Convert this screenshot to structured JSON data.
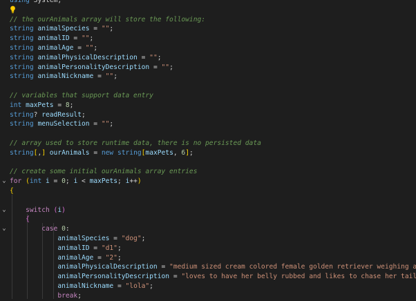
{
  "editor": {
    "language": "C#",
    "colors": {
      "background": "#1e1e1e",
      "keyword": "#569cd6",
      "control": "#c586c0",
      "identifier": "#9cdcfe",
      "string": "#ce9178",
      "number": "#b5cea8",
      "comment": "#6a9955"
    },
    "lines": [
      [
        [
          "using",
          "kw"
        ],
        [
          " System;",
          "pl"
        ]
      ],
      [],
      [
        [
          "// the ourAnimals array will store the following:",
          "cmt"
        ]
      ],
      [
        [
          "string",
          "kw"
        ],
        [
          " ",
          "pl"
        ],
        [
          "animalSpecies",
          "id"
        ],
        [
          " = ",
          "pl"
        ],
        [
          "\"\"",
          "str"
        ],
        [
          ";",
          "pl"
        ]
      ],
      [
        [
          "string",
          "kw"
        ],
        [
          " ",
          "pl"
        ],
        [
          "animalID",
          "id"
        ],
        [
          " = ",
          "pl"
        ],
        [
          "\"\"",
          "str"
        ],
        [
          ";",
          "pl"
        ]
      ],
      [
        [
          "string",
          "kw"
        ],
        [
          " ",
          "pl"
        ],
        [
          "animalAge",
          "id"
        ],
        [
          " = ",
          "pl"
        ],
        [
          "\"\"",
          "str"
        ],
        [
          ";",
          "pl"
        ]
      ],
      [
        [
          "string",
          "kw"
        ],
        [
          " ",
          "pl"
        ],
        [
          "animalPhysicalDescription",
          "id"
        ],
        [
          " = ",
          "pl"
        ],
        [
          "\"\"",
          "str"
        ],
        [
          ";",
          "pl"
        ]
      ],
      [
        [
          "string",
          "kw"
        ],
        [
          " ",
          "pl"
        ],
        [
          "animalPersonalityDescription",
          "id"
        ],
        [
          " = ",
          "pl"
        ],
        [
          "\"\"",
          "str"
        ],
        [
          ";",
          "pl"
        ]
      ],
      [
        [
          "string",
          "kw"
        ],
        [
          " ",
          "pl"
        ],
        [
          "animalNickname",
          "id"
        ],
        [
          " = ",
          "pl"
        ],
        [
          "\"\"",
          "str"
        ],
        [
          ";",
          "pl"
        ]
      ],
      [],
      [
        [
          "// variables that support data entry",
          "cmt"
        ]
      ],
      [
        [
          "int",
          "kw"
        ],
        [
          " ",
          "pl"
        ],
        [
          "maxPets",
          "id"
        ],
        [
          " = ",
          "pl"
        ],
        [
          "8",
          "num"
        ],
        [
          ";",
          "pl"
        ]
      ],
      [
        [
          "string",
          "kw"
        ],
        [
          "? ",
          "pl"
        ],
        [
          "readResult",
          "id"
        ],
        [
          ";",
          "pl"
        ]
      ],
      [
        [
          "string",
          "kw"
        ],
        [
          " ",
          "pl"
        ],
        [
          "menuSelection",
          "id"
        ],
        [
          " = ",
          "pl"
        ],
        [
          "\"\"",
          "str"
        ],
        [
          ";",
          "pl"
        ]
      ],
      [],
      [
        [
          "// array used to store runtime data, there is no persisted data",
          "cmt"
        ]
      ],
      [
        [
          "string",
          "kw"
        ],
        [
          "[",
          "br1"
        ],
        [
          ",",
          "pl"
        ],
        [
          "]",
          "br1"
        ],
        [
          " ",
          "pl"
        ],
        [
          "ourAnimals",
          "id"
        ],
        [
          " = ",
          "pl"
        ],
        [
          "new",
          "kw"
        ],
        [
          " ",
          "pl"
        ],
        [
          "string",
          "kw"
        ],
        [
          "[",
          "br1"
        ],
        [
          "maxPets",
          "id"
        ],
        [
          ", ",
          "pl"
        ],
        [
          "6",
          "num"
        ],
        [
          "]",
          "br1"
        ],
        [
          ";",
          "pl"
        ]
      ],
      [],
      [
        [
          "// create some initial ourAnimals array entries",
          "cmt"
        ]
      ],
      [
        [
          "for",
          "ctl"
        ],
        [
          " ",
          "pl"
        ],
        [
          "(",
          "br1"
        ],
        [
          "int",
          "kw"
        ],
        [
          " ",
          "pl"
        ],
        [
          "i",
          "id"
        ],
        [
          " = ",
          "pl"
        ],
        [
          "0",
          "num"
        ],
        [
          "; ",
          "pl"
        ],
        [
          "i",
          "id"
        ],
        [
          " < ",
          "pl"
        ],
        [
          "maxPets",
          "id"
        ],
        [
          "; ",
          "pl"
        ],
        [
          "i",
          "id"
        ],
        [
          "++",
          "pl"
        ],
        [
          ")",
          "br1"
        ]
      ],
      [
        [
          "{",
          "br1"
        ]
      ],
      [],
      [
        [
          "    ",
          "pl"
        ],
        [
          "switch",
          "ctl"
        ],
        [
          " ",
          "pl"
        ],
        [
          "(",
          "br2"
        ],
        [
          "i",
          "id"
        ],
        [
          ")",
          "br2"
        ]
      ],
      [
        [
          "    ",
          "pl"
        ],
        [
          "{",
          "br2"
        ]
      ],
      [
        [
          "        ",
          "pl"
        ],
        [
          "case",
          "ctl"
        ],
        [
          " ",
          "pl"
        ],
        [
          "0",
          "num"
        ],
        [
          ":",
          "pl"
        ]
      ],
      [
        [
          "            ",
          "pl"
        ],
        [
          "animalSpecies",
          "id"
        ],
        [
          " = ",
          "pl"
        ],
        [
          "\"dog\"",
          "str"
        ],
        [
          ";",
          "pl"
        ]
      ],
      [
        [
          "            ",
          "pl"
        ],
        [
          "animalID",
          "id"
        ],
        [
          " = ",
          "pl"
        ],
        [
          "\"d1\"",
          "str"
        ],
        [
          ";",
          "pl"
        ]
      ],
      [
        [
          "            ",
          "pl"
        ],
        [
          "animalAge",
          "id"
        ],
        [
          " = ",
          "pl"
        ],
        [
          "\"2\"",
          "str"
        ],
        [
          ";",
          "pl"
        ]
      ],
      [
        [
          "            ",
          "pl"
        ],
        [
          "animalPhysicalDescription",
          "id"
        ],
        [
          " = ",
          "pl"
        ],
        [
          "\"medium sized cream colored female golden retriever weighing abou",
          "str"
        ]
      ],
      [
        [
          "            ",
          "pl"
        ],
        [
          "animalPersonalityDescription",
          "id"
        ],
        [
          " = ",
          "pl"
        ],
        [
          "\"loves to have her belly rubbed and likes to chase her tail. g",
          "str"
        ]
      ],
      [
        [
          "            ",
          "pl"
        ],
        [
          "animalNickname",
          "id"
        ],
        [
          " = ",
          "pl"
        ],
        [
          "\"lola\"",
          "str"
        ],
        [
          ";",
          "pl"
        ]
      ],
      [
        [
          "            ",
          "pl"
        ],
        [
          "break",
          "ctl"
        ],
        [
          ";",
          "pl"
        ]
      ]
    ],
    "folds": [
      {
        "line": 19,
        "glyph": "⌄"
      },
      {
        "line": 22,
        "glyph": "⌄"
      },
      {
        "line": 24,
        "glyph": "⌄"
      }
    ],
    "lightbulb_line": 1
  }
}
